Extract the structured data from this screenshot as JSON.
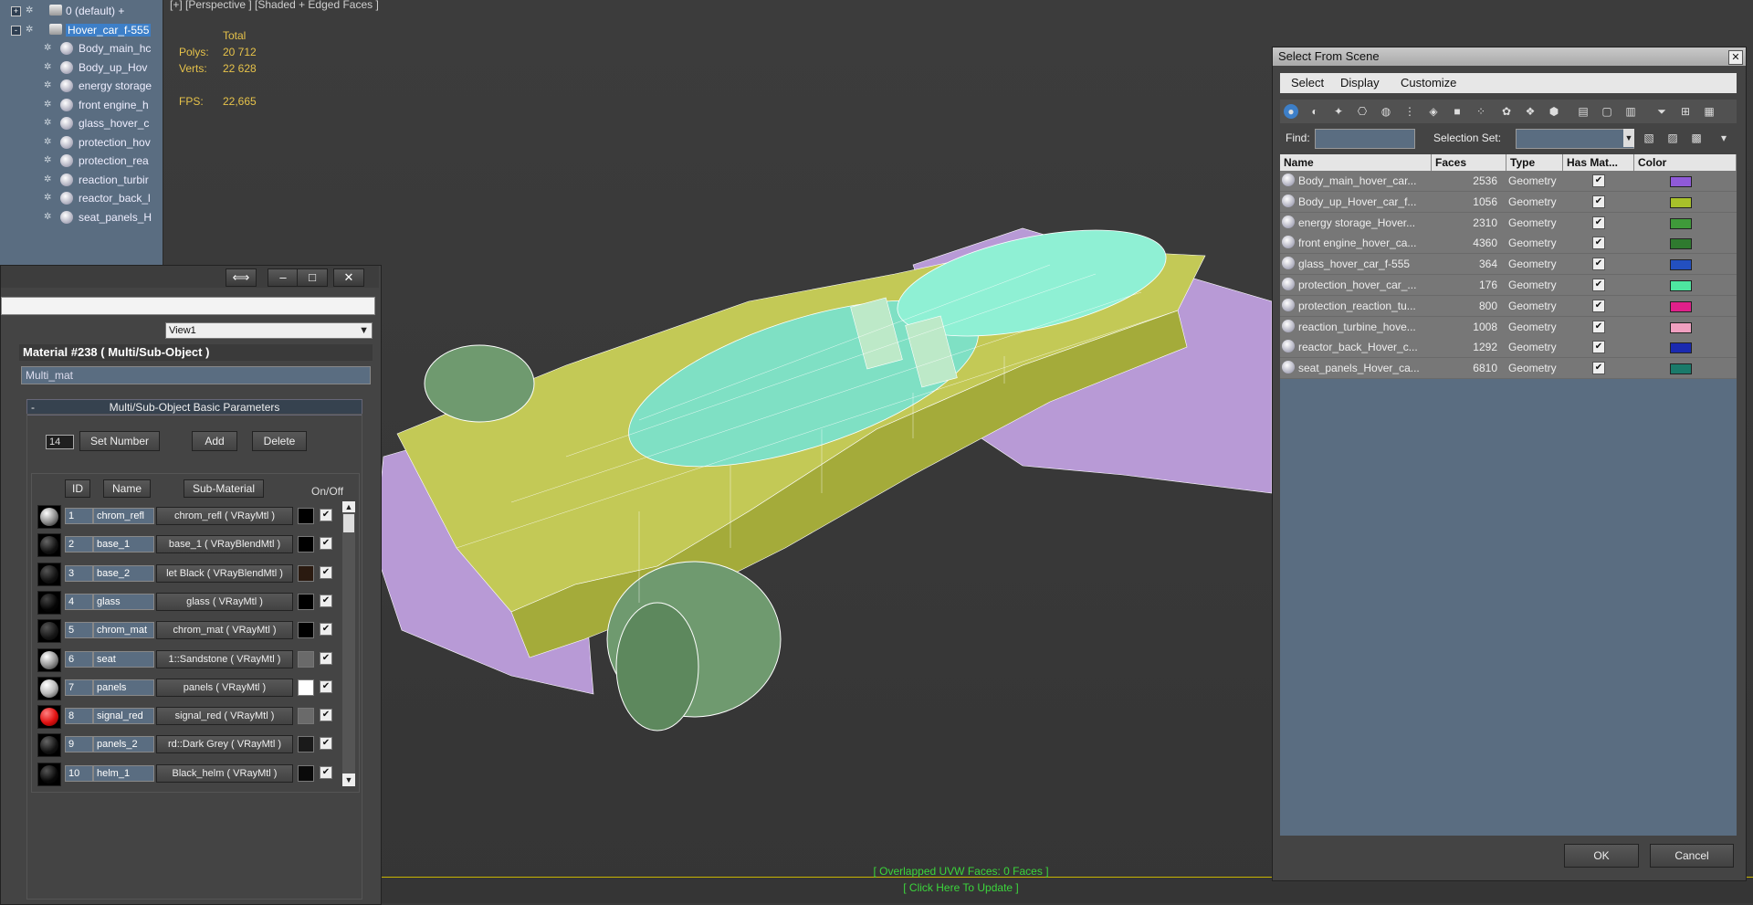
{
  "viewport": {
    "label": "[+] [Perspective ] [Shaded + Edged Faces ]",
    "stats": {
      "total_label": "Total",
      "polys_label": "Polys:",
      "polys": "20 712",
      "verts_label": "Verts:",
      "verts": "22 628",
      "fps_label": "FPS:",
      "fps": "22,665"
    },
    "uvw_status": "[ Overlapped UVW Faces: 0 Faces ]",
    "update_link": "[ Click Here To Update ]",
    "colors": {
      "body": "#b89ad6",
      "hull": "#c3c956",
      "glass": "#7fe0c4",
      "engine": "#6f9a6f",
      "wire": "#ffffff"
    }
  },
  "scene_tree": {
    "items": [
      {
        "label": "0 (default) +",
        "kind": "layer",
        "expander": "+"
      },
      {
        "label": "Hover_car_f-555",
        "kind": "layer",
        "expander": "-",
        "selected": true
      },
      {
        "label": "Body_main_hc",
        "kind": "object"
      },
      {
        "label": "Body_up_Hov",
        "kind": "object"
      },
      {
        "label": "energy storage",
        "kind": "object"
      },
      {
        "label": "front engine_h",
        "kind": "object"
      },
      {
        "label": "glass_hover_c",
        "kind": "object"
      },
      {
        "label": "protection_hov",
        "kind": "object"
      },
      {
        "label": "protection_rea",
        "kind": "object"
      },
      {
        "label": "reaction_turbir",
        "kind": "object"
      },
      {
        "label": "reactor_back_l",
        "kind": "object"
      },
      {
        "label": "seat_panels_H",
        "kind": "object"
      }
    ]
  },
  "material_editor": {
    "view_select": "View1",
    "header": "Material #238  ( Multi/Sub-Object )",
    "name_field": "Multi_mat",
    "rollout_title": "Multi/Sub-Object Basic Parameters",
    "rollout_toggle": "-",
    "num_value": "14",
    "buttons": {
      "set_number": "Set Number",
      "add": "Add",
      "delete": "Delete"
    },
    "columns": {
      "id": "ID",
      "name": "Name",
      "sub": "Sub-Material",
      "onoff": "On/Off"
    },
    "rows": [
      {
        "id": "1",
        "name": "chrom_refl",
        "sub": "chrom_refl  ( VRayMtl )",
        "swatch": "#000000",
        "ball": "radial-gradient(circle at 35% 30%,#ffffff,#888 55%,#111)",
        "check": "✔"
      },
      {
        "id": "2",
        "name": "base_1",
        "sub": "base_1  ( VRayBlendMtl )",
        "swatch": "#000000",
        "ball": "radial-gradient(circle at 35% 30%,#666,#111 60%,#000)",
        "check": "✔"
      },
      {
        "id": "3",
        "name": "base_2",
        "sub": "let Black  ( VRayBlendMtl )",
        "swatch": "#2a1a10",
        "ball": "radial-gradient(circle at 35% 30%,#555,#111 60%,#000)",
        "check": "✔"
      },
      {
        "id": "4",
        "name": "glass",
        "sub": "glass  ( VRayMtl )",
        "swatch": "#000000",
        "ball": "radial-gradient(circle at 35% 30%,#444,#050505 60%,#000)",
        "check": "✔"
      },
      {
        "id": "5",
        "name": "chrom_mat",
        "sub": "chrom_mat  ( VRayMtl )",
        "swatch": "#000000",
        "ball": "radial-gradient(circle at 35% 30%,#555,#151515 60%,#000)",
        "check": "✔"
      },
      {
        "id": "6",
        "name": "seat",
        "sub": "1::Sandstone  ( VRayMtl )",
        "swatch": "#6a6a6a",
        "ball": "radial-gradient(circle at 35% 30%,#fff,#999 50%,#222)",
        "check": "✔"
      },
      {
        "id": "7",
        "name": "panels",
        "sub": "panels  ( VRayMtl )",
        "swatch": "#ffffff",
        "ball": "radial-gradient(circle at 35% 30%,#fff,#bbb 50%,#333)",
        "check": "✔"
      },
      {
        "id": "8",
        "name": "signal_red",
        "sub": "signal_red  ( VRayMtl )",
        "swatch": "#6a6a6a",
        "ball": "radial-gradient(circle at 35% 30%,#ff8080,#e01010 55%,#600)",
        "check": "✔"
      },
      {
        "id": "9",
        "name": "panels_2",
        "sub": "rd::Dark Grey  ( VRayMtl )",
        "swatch": "#1a1a1a",
        "ball": "radial-gradient(circle at 35% 30%,#666,#111 60%,#000)",
        "check": "✔"
      },
      {
        "id": "10",
        "name": "helm_1",
        "sub": "Black_helm  ( VRayMtl )",
        "swatch": "#0a0a0a",
        "ball": "radial-gradient(circle at 35% 30%,#555,#080808 60%,#000)",
        "check": "✔"
      }
    ]
  },
  "select_from_scene": {
    "title": "Select From Scene",
    "menu": [
      "Select",
      "Display",
      "Customize"
    ],
    "find_label": "Find:",
    "selset_label": "Selection Set:",
    "columns": {
      "name": "Name",
      "faces": "Faces",
      "type": "Type",
      "has_mat": "Has Mat...",
      "color": "Color"
    },
    "rows": [
      {
        "name": "Body_main_hover_car...",
        "faces": "2536",
        "type": "Geometry",
        "check": "✔",
        "color": "#8f5ad8"
      },
      {
        "name": "Body_up_Hover_car_f...",
        "faces": "1056",
        "type": "Geometry",
        "check": "✔",
        "color": "#a8c02a"
      },
      {
        "name": "energy storage_Hover...",
        "faces": "2310",
        "type": "Geometry",
        "check": "✔",
        "color": "#3f9a3a"
      },
      {
        "name": "front engine_hover_ca...",
        "faces": "4360",
        "type": "Geometry",
        "check": "✔",
        "color": "#2f7a2f"
      },
      {
        "name": "glass_hover_car_f-555",
        "faces": "364",
        "type": "Geometry",
        "check": "✔",
        "color": "#2350c0"
      },
      {
        "name": "protection_hover_car_...",
        "faces": "176",
        "type": "Geometry",
        "check": "✔",
        "color": "#4ee6a0"
      },
      {
        "name": "protection_reaction_tu...",
        "faces": "800",
        "type": "Geometry",
        "check": "✔",
        "color": "#e0208a"
      },
      {
        "name": "reaction_turbine_hove...",
        "faces": "1008",
        "type": "Geometry",
        "check": "✔",
        "color": "#f0a0c0"
      },
      {
        "name": "reactor_back_Hover_c...",
        "faces": "1292",
        "type": "Geometry",
        "check": "✔",
        "color": "#1a2ab0"
      },
      {
        "name": "seat_panels_Hover_ca...",
        "faces": "6810",
        "type": "Geometry",
        "check": "✔",
        "color": "#1a7a6a"
      }
    ],
    "ok_label": "OK",
    "cancel_label": "Cancel"
  }
}
